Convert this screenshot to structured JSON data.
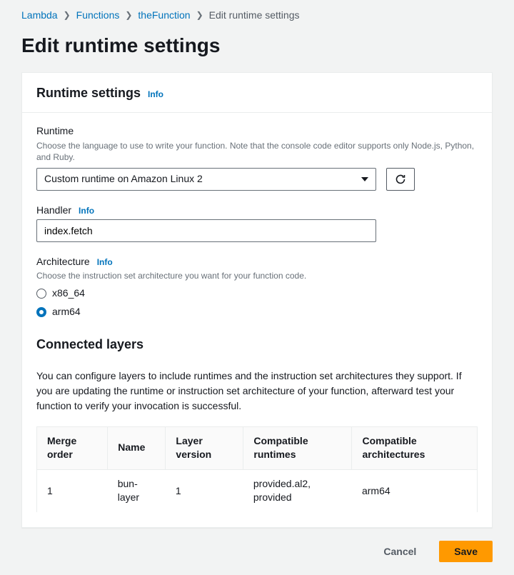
{
  "breadcrumb": {
    "items": [
      "Lambda",
      "Functions",
      "theFunction"
    ],
    "current": "Edit runtime settings"
  },
  "page_title": "Edit runtime settings",
  "panel": {
    "title": "Runtime settings",
    "info": "Info"
  },
  "runtime": {
    "label": "Runtime",
    "help": "Choose the language to use to write your function. Note that the console code editor supports only Node.js, Python, and Ruby.",
    "value": "Custom runtime on Amazon Linux 2"
  },
  "handler": {
    "label": "Handler",
    "info": "Info",
    "value": "index.fetch"
  },
  "architecture": {
    "label": "Architecture",
    "info": "Info",
    "help": "Choose the instruction set architecture you want for your function code.",
    "options": [
      "x86_64",
      "arm64"
    ],
    "selected": "arm64"
  },
  "layers": {
    "heading": "Connected layers",
    "description": "You can configure layers to include runtimes and the instruction set architectures they support. If you are updating the runtime or instruction set architecture of your function, afterward test your function to verify your invocation is successful.",
    "columns": [
      "Merge order",
      "Name",
      "Layer version",
      "Compatible runtimes",
      "Compatible architectures"
    ],
    "rows": [
      {
        "order": "1",
        "name": "bun-layer",
        "version": "1",
        "runtimes": "provided.al2, provided",
        "arch": "arm64"
      }
    ]
  },
  "actions": {
    "cancel": "Cancel",
    "save": "Save"
  }
}
